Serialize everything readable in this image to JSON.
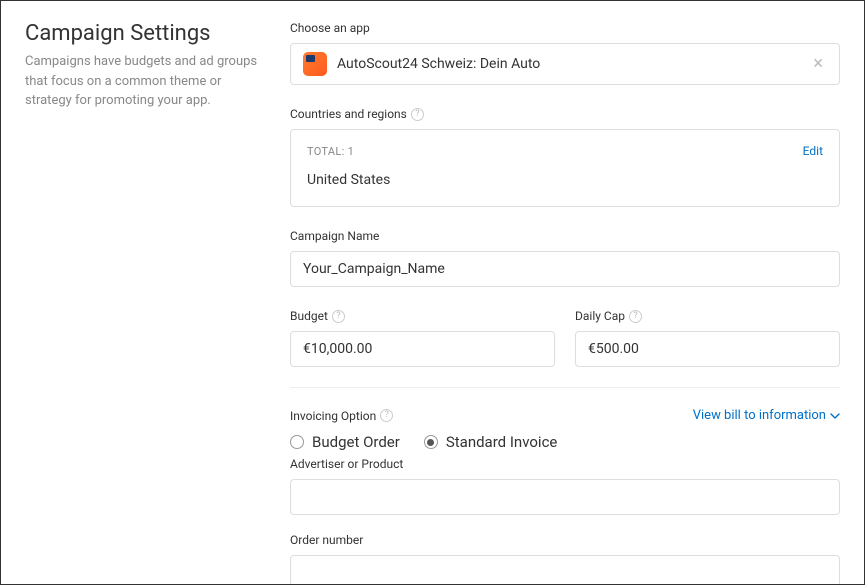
{
  "left": {
    "title": "Campaign Settings",
    "description": "Campaigns have budgets and ad groups that focus on a common theme or strategy for promoting your app."
  },
  "app": {
    "sectionLabel": "Choose an app",
    "name": "AutoScout24 Schweiz: Dein Auto"
  },
  "countries": {
    "sectionLabel": "Countries and regions",
    "totalLabel": "TOTAL: 1",
    "editLabel": "Edit",
    "value": "United States"
  },
  "campaignName": {
    "label": "Campaign Name",
    "value": "Your_Campaign_Name"
  },
  "budget": {
    "label": "Budget",
    "value": "€10,000.00"
  },
  "dailyCap": {
    "label": "Daily Cap",
    "value": "€500.00"
  },
  "invoicing": {
    "label": "Invoicing Option",
    "viewBill": "View bill to information",
    "options": {
      "budgetOrder": "Budget Order",
      "standardInvoice": "Standard Invoice"
    },
    "selected": "standardInvoice"
  },
  "advertiser": {
    "label": "Advertiser or Product",
    "value": ""
  },
  "orderNumber": {
    "label": "Order number",
    "value": ""
  }
}
